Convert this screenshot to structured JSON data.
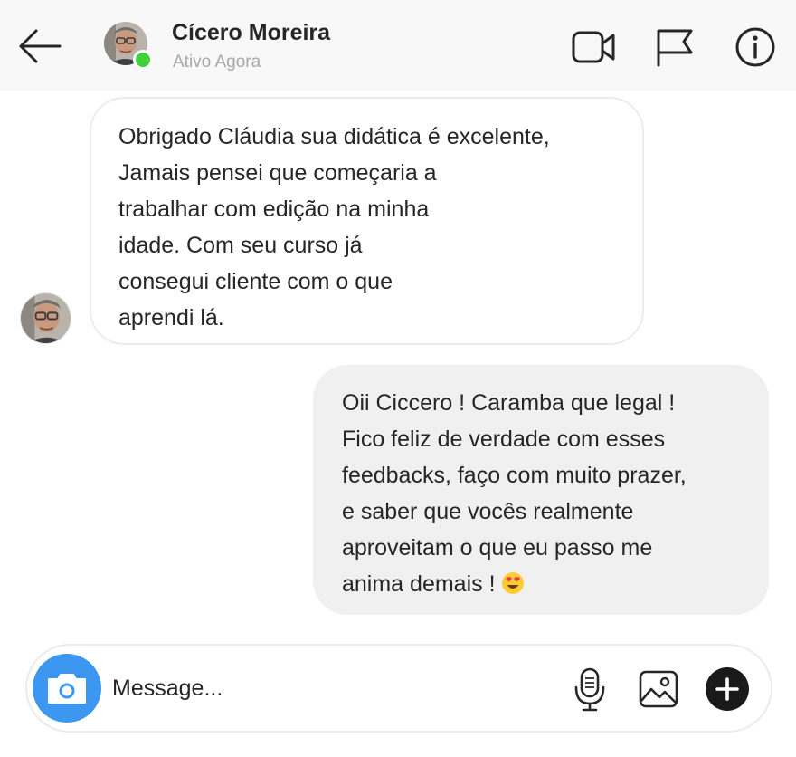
{
  "header": {
    "contact_name": "Cícero Moreira",
    "status": "Ativo Agora",
    "status_color": "#3fd03a",
    "icons": [
      "back-arrow-icon",
      "video-camera-icon",
      "flag-icon",
      "info-icon"
    ]
  },
  "messages": [
    {
      "direction": "received",
      "text": "Obrigado Cláudia sua didática é excelente,\nJamais pensei que começaria a\ntrabalhar com edição na minha\nidade. Com seu curso já\nconsegui cliente com o que\naprendi lá."
    },
    {
      "direction": "sent",
      "text": "Oii Ciccero ! Caramba que legal !\nFico feliz de verdade com esses\nfeedbacks, faço com muito prazer,\ne saber que vocês realmente\naproveitam o que eu passo me\nanima demais ! ",
      "emoji": "heart-eyes-emoji-icon"
    }
  ],
  "composer": {
    "placeholder": "Message...",
    "value": "",
    "camera_color": "#3b97f0",
    "icons": [
      "camera-icon",
      "microphone-icon",
      "image-icon",
      "plus-icon"
    ]
  }
}
